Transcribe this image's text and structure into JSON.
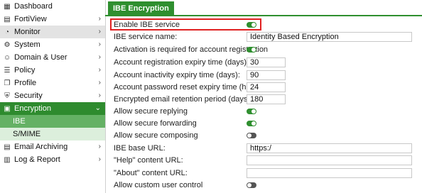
{
  "sidebar": {
    "items": [
      {
        "label": "Dashboard",
        "icon": "dashboard-icon",
        "glyph": "▦",
        "chevron": false
      },
      {
        "label": "FortiView",
        "icon": "fortiview-icon",
        "glyph": "▤",
        "chevron": true
      },
      {
        "label": "Monitor",
        "icon": "monitor-icon",
        "glyph": "◔",
        "chevron": true
      },
      {
        "label": "System",
        "icon": "system-icon",
        "glyph": "⚙",
        "chevron": true
      },
      {
        "label": "Domain & User",
        "icon": "user-icon",
        "glyph": "☺",
        "chevron": true
      },
      {
        "label": "Policy",
        "icon": "policy-icon",
        "glyph": "☰",
        "chevron": true
      },
      {
        "label": "Profile",
        "icon": "profile-icon",
        "glyph": "❐",
        "chevron": true
      },
      {
        "label": "Security",
        "icon": "shield-icon",
        "glyph": "⛨",
        "chevron": true
      },
      {
        "label": "Encryption",
        "icon": "lock-icon",
        "glyph": "▣",
        "chevron": true
      },
      {
        "label": "IBE",
        "icon": "",
        "glyph": "",
        "chevron": false
      },
      {
        "label": "S/MIME",
        "icon": "",
        "glyph": "",
        "chevron": false
      },
      {
        "label": "Email Archiving",
        "icon": "archive-icon",
        "glyph": "▤",
        "chevron": true
      },
      {
        "label": "Log & Report",
        "icon": "report-icon",
        "glyph": "▥",
        "chevron": true
      }
    ]
  },
  "tab": {
    "label": "IBE Encryption"
  },
  "form": {
    "enable_ibe_service": {
      "label": "Enable IBE service",
      "value": true
    },
    "ibe_service_name": {
      "label": "IBE service name:",
      "value": "Identity Based Encryption"
    },
    "activation_required": {
      "label": "Activation is required for account registration",
      "value": true
    },
    "registration_expiry": {
      "label": "Account registration expiry time (days):",
      "value": "30"
    },
    "inactivity_expiry": {
      "label": "Account inactivity expiry time (days):",
      "value": "90"
    },
    "password_reset_expiry": {
      "label": "Account password reset expiry time (hours):",
      "value": "24"
    },
    "retention_period": {
      "label": "Encrypted email retention period (days):",
      "value": "180"
    },
    "allow_secure_replying": {
      "label": "Allow secure replying",
      "value": true
    },
    "allow_secure_forwarding": {
      "label": "Allow secure forwarding",
      "value": true
    },
    "allow_secure_composing": {
      "label": "Allow secure composing",
      "value": false
    },
    "ibe_base_url": {
      "label": "IBE base URL:",
      "value": "https:/"
    },
    "help_url": {
      "label": "\"Help\" content URL:",
      "value": ""
    },
    "about_url": {
      "label": "\"About\" content URL:",
      "value": ""
    },
    "allow_custom_user_control": {
      "label": "Allow custom user control",
      "value": false
    }
  },
  "colors": {
    "accent": "#2f8f2f",
    "highlight_box": "#e02020"
  }
}
